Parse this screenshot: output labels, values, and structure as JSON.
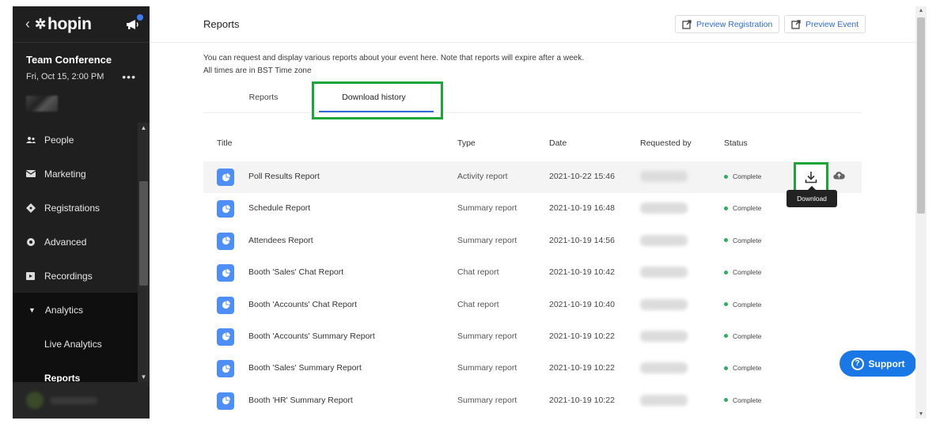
{
  "sidebar": {
    "logo_text": "hopin",
    "event_title": "Team Conference",
    "event_date": "Fri, Oct 15, 2:00 PM",
    "more_label": "•••",
    "items": [
      {
        "label": "People",
        "icon": "people-icon"
      },
      {
        "label": "Marketing",
        "icon": "mail-icon"
      },
      {
        "label": "Registrations",
        "icon": "ticket-icon"
      },
      {
        "label": "Advanced",
        "icon": "gear-icon"
      },
      {
        "label": "Recordings",
        "icon": "recording-icon"
      }
    ],
    "analytics_label": "Analytics",
    "sub_items": [
      {
        "label": "Live Analytics"
      },
      {
        "label": "Reports"
      }
    ]
  },
  "header": {
    "title": "Reports",
    "preview_registration": "Preview Registration",
    "preview_event": "Preview Event"
  },
  "intro": {
    "line1": "You can request and display various reports about your event here. Note that reports will expire after a week.",
    "line2": "All times are in BST Time zone"
  },
  "tabs": {
    "reports": "Reports",
    "download_history": "Download history"
  },
  "table": {
    "columns": {
      "title": "Title",
      "type": "Type",
      "date": "Date",
      "requested_by": "Requested by",
      "status": "Status"
    },
    "rows": [
      {
        "title": "Poll Results Report",
        "type": "Activity report",
        "date": "2021-10-22 15:46",
        "status": "Complete"
      },
      {
        "title": "Schedule Report",
        "type": "Summary report",
        "date": "2021-10-19 16:48",
        "status": "Complete"
      },
      {
        "title": "Attendees Report",
        "type": "Summary report",
        "date": "2021-10-19 14:56",
        "status": "Complete"
      },
      {
        "title": "Booth 'Sales' Chat Report",
        "type": "Chat report",
        "date": "2021-10-19 10:42",
        "status": "Complete"
      },
      {
        "title": "Booth 'Accounts' Chat Report",
        "type": "Chat report",
        "date": "2021-10-19 10:40",
        "status": "Complete"
      },
      {
        "title": "Booth 'Accounts' Summary Report",
        "type": "Summary report",
        "date": "2021-10-19 10:22",
        "status": "Complete"
      },
      {
        "title": "Booth 'Sales' Summary Report",
        "type": "Summary report",
        "date": "2021-10-19 10:22",
        "status": "Complete"
      },
      {
        "title": "Booth 'HR' Summary Report",
        "type": "Summary report",
        "date": "2021-10-19 10:22",
        "status": "Complete"
      }
    ],
    "download_tooltip": "Download"
  },
  "support": {
    "label": "Support"
  },
  "colors": {
    "accent": "#2f6bd8",
    "highlight": "#1ea53a",
    "status_complete": "#2fae62",
    "sidebar_bg": "#1f1f1f",
    "report_icon": "#4d8ef7"
  }
}
